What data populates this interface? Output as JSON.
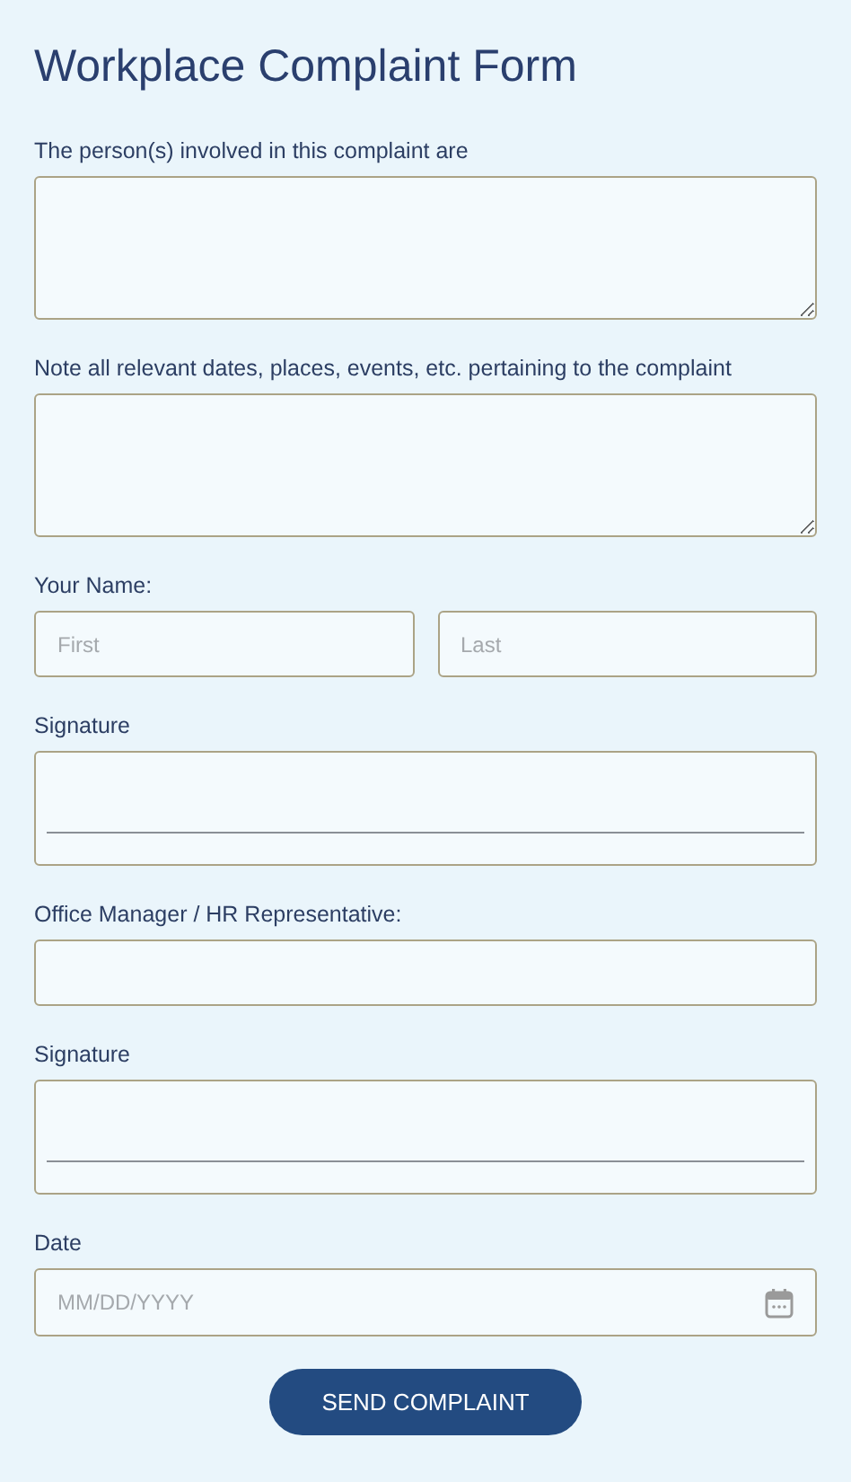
{
  "title": "Workplace Complaint Form",
  "fields": [
    {
      "kind": "textarea",
      "label": "The person(s) involved in this complaint are"
    },
    {
      "kind": "textarea",
      "label": "Note all relevant dates, places, events, etc. pertaining to the complaint"
    },
    {
      "kind": "name",
      "label": "Your Name:",
      "parts": [
        {
          "placeholder": "First"
        },
        {
          "placeholder": "Last"
        }
      ]
    },
    {
      "kind": "signature",
      "label": "Signature"
    },
    {
      "kind": "text",
      "label": "Office Manager / HR Representative:"
    },
    {
      "kind": "signature",
      "label": "Signature"
    },
    {
      "kind": "date",
      "label": "Date",
      "placeholder": "MM/DD/YYYY"
    }
  ],
  "submit": "SEND COMPLAINT"
}
